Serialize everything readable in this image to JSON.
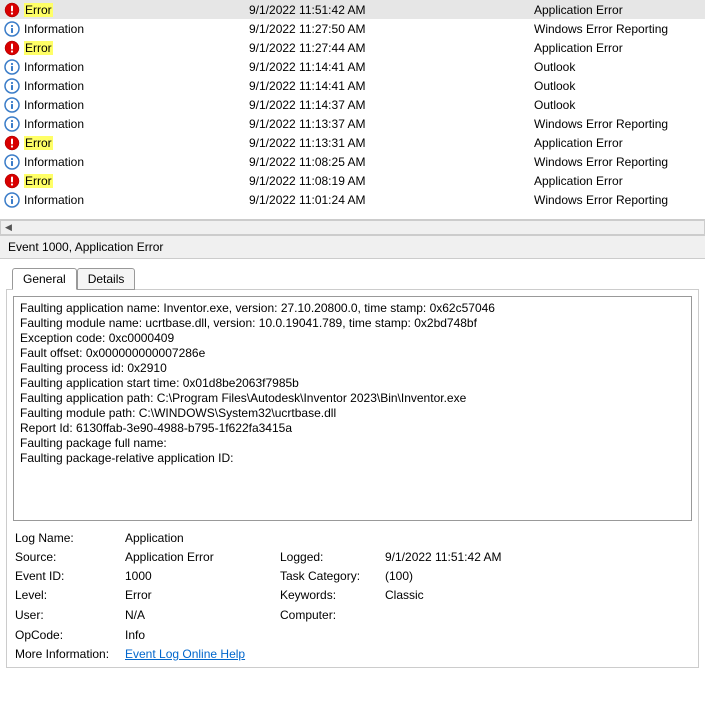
{
  "event_rows": [
    {
      "level": "Error",
      "highlighted": true,
      "selected": true,
      "date": "9/1/2022 11:51:42 AM",
      "source": "Application Error",
      "icon": "error"
    },
    {
      "level": "Information",
      "highlighted": false,
      "selected": false,
      "date": "9/1/2022 11:27:50 AM",
      "source": "Windows Error Reporting",
      "icon": "info"
    },
    {
      "level": "Error",
      "highlighted": true,
      "selected": false,
      "date": "9/1/2022 11:27:44 AM",
      "source": "Application Error",
      "icon": "error"
    },
    {
      "level": "Information",
      "highlighted": false,
      "selected": false,
      "date": "9/1/2022 11:14:41 AM",
      "source": "Outlook",
      "icon": "info"
    },
    {
      "level": "Information",
      "highlighted": false,
      "selected": false,
      "date": "9/1/2022 11:14:41 AM",
      "source": "Outlook",
      "icon": "info"
    },
    {
      "level": "Information",
      "highlighted": false,
      "selected": false,
      "date": "9/1/2022 11:14:37 AM",
      "source": "Outlook",
      "icon": "info"
    },
    {
      "level": "Information",
      "highlighted": false,
      "selected": false,
      "date": "9/1/2022 11:13:37 AM",
      "source": "Windows Error Reporting",
      "icon": "info"
    },
    {
      "level": "Error",
      "highlighted": true,
      "selected": false,
      "date": "9/1/2022 11:13:31 AM",
      "source": "Application Error",
      "icon": "error"
    },
    {
      "level": "Information",
      "highlighted": false,
      "selected": false,
      "date": "9/1/2022 11:08:25 AM",
      "source": "Windows Error Reporting",
      "icon": "info"
    },
    {
      "level": "Error",
      "highlighted": true,
      "selected": false,
      "date": "9/1/2022 11:08:19 AM",
      "source": "Application Error",
      "icon": "error"
    },
    {
      "level": "Information",
      "highlighted": false,
      "selected": false,
      "date": "9/1/2022 11:01:24 AM",
      "source": "Windows Error Reporting",
      "icon": "info"
    }
  ],
  "header": "Event 1000, Application Error",
  "tabs": {
    "general": "General",
    "details": "Details"
  },
  "description_lines": [
    "Faulting application name: Inventor.exe, version: 27.10.20800.0, time stamp: 0x62c57046",
    "Faulting module name: ucrtbase.dll, version: 10.0.19041.789, time stamp: 0x2bd748bf",
    "Exception code: 0xc0000409",
    "Fault offset: 0x000000000007286e",
    "Faulting process id: 0x2910",
    "Faulting application start time: 0x01d8be2063f7985b",
    "Faulting application path: C:\\Program Files\\Autodesk\\Inventor 2023\\Bin\\Inventor.exe",
    "Faulting module path: C:\\WINDOWS\\System32\\ucrtbase.dll",
    "Report Id: 6130ffab-3e90-4988-b795-1f622fa3415a",
    "Faulting package full name:",
    "Faulting package-relative application ID:"
  ],
  "meta": {
    "log_name_label": "Log Name:",
    "log_name": "Application",
    "source_label": "Source:",
    "source": "Application Error",
    "logged_label": "Logged:",
    "logged": "9/1/2022 11:51:42 AM",
    "eventid_label": "Event ID:",
    "eventid": "1000",
    "taskcat_label": "Task Category:",
    "taskcat": "(100)",
    "level_label": "Level:",
    "level": "Error",
    "keywords_label": "Keywords:",
    "keywords": "Classic",
    "user_label": "User:",
    "user": "N/A",
    "computer_label": "Computer:",
    "computer": "",
    "opcode_label": "OpCode:",
    "opcode": "Info",
    "moreinfo_label": "More Information:",
    "moreinfo_link": "Event Log Online Help"
  }
}
